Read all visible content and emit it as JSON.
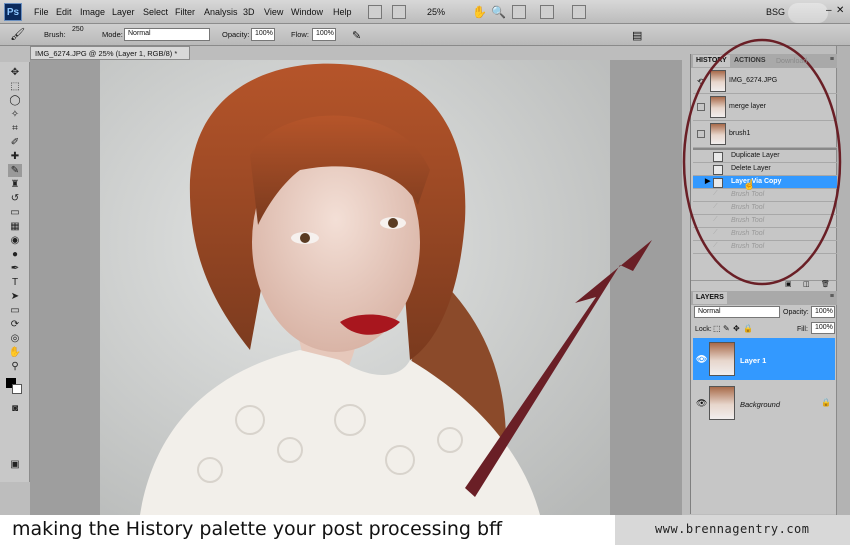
{
  "app": {
    "logo": "Ps"
  },
  "menu": [
    "File",
    "Edit",
    "Image",
    "Layer",
    "Select",
    "Filter",
    "Analysis",
    "3D",
    "View",
    "Window",
    "Help"
  ],
  "zoom": "25%",
  "workspace": "BSG",
  "options": {
    "brush_label": "Brush:",
    "brush_size": "250",
    "mode_label": "Mode:",
    "mode_value": "Normal",
    "opacity_label": "Opacity:",
    "opacity_value": "100%",
    "flow_label": "Flow:",
    "flow_value": "100%"
  },
  "document": {
    "tab_title": "IMG_6274.JPG @ 25% (Layer 1, RGB/8) *"
  },
  "history": {
    "tabs": [
      "HISTORY",
      "ACTIONS"
    ],
    "snapshots": [
      "IMG_6274.JPG",
      "merge layer",
      "brush1"
    ],
    "states": [
      {
        "label": "Duplicate Layer",
        "state": "normal"
      },
      {
        "label": "Delete Layer",
        "state": "normal"
      },
      {
        "label": "Layer Via Copy",
        "state": "active"
      },
      {
        "label": "Brush Tool",
        "state": "dimmed"
      },
      {
        "label": "Brush Tool",
        "state": "dimmed"
      },
      {
        "label": "Brush Tool",
        "state": "dimmed"
      },
      {
        "label": "Brush Tool",
        "state": "dimmed"
      },
      {
        "label": "Brush Tool",
        "state": "dimmed"
      }
    ]
  },
  "layers": {
    "tab": "LAYERS",
    "blend_mode": "Normal",
    "opacity_label": "Opacity:",
    "opacity_value": "100%",
    "lock_label": "Lock:",
    "fill_label": "Fill:",
    "fill_value": "100%",
    "items": [
      {
        "name": "Layer 1",
        "selected": true
      },
      {
        "name": "Background",
        "selected": false
      }
    ]
  },
  "overlay": {
    "watermark": "Download",
    "caption": "making the History palette your post processing bff",
    "site": "www.brennagentry.com"
  },
  "colors": {
    "highlight": "#3399ff",
    "arrow": "#6a1f26",
    "circle": "#6a1f26"
  }
}
